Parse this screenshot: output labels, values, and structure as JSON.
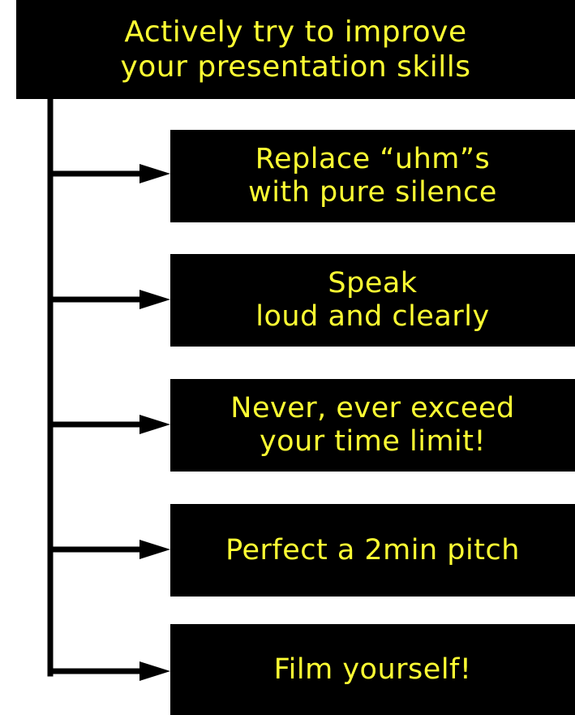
{
  "diagram": {
    "root": {
      "label": "Actively try to improve\nyour presentation skills"
    },
    "children": [
      {
        "label": "Replace “uhm”s\nwith pure silence"
      },
      {
        "label": "Speak\nloud and clearly"
      },
      {
        "label": "Never, ever exceed\nyour time limit!"
      },
      {
        "label": "Perfect a 2min pitch"
      },
      {
        "label": "Film yourself!"
      }
    ],
    "colors": {
      "box_background": "#000000",
      "text": "#ffff33",
      "connector": "#000000",
      "page_background": "#ffffff"
    }
  }
}
